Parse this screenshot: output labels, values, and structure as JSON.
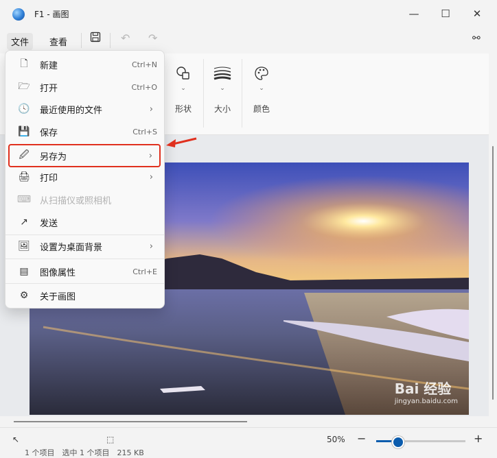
{
  "window": {
    "title": "F1 - 画图"
  },
  "menubar": {
    "file": "文件",
    "view": "查看"
  },
  "ribbon": {
    "shapes_label": "形状",
    "size_label": "大小",
    "colors_label": "颜色"
  },
  "file_menu": {
    "items": [
      {
        "label": "新建",
        "shortcut": "Ctrl+N",
        "icon": "new-file-icon"
      },
      {
        "label": "打开",
        "shortcut": "Ctrl+O",
        "icon": "folder-open-icon"
      },
      {
        "label": "最近使用的文件",
        "shortcut": "",
        "icon": "clock-icon",
        "submenu": true
      },
      {
        "label": "保存",
        "shortcut": "Ctrl+S",
        "icon": "save-icon"
      },
      {
        "label": "另存为",
        "shortcut": "",
        "icon": "save-as-icon",
        "submenu": true,
        "highlighted": true
      },
      {
        "label": "打印",
        "shortcut": "",
        "icon": "printer-icon",
        "submenu": true
      },
      {
        "label": "从扫描仪或照相机",
        "shortcut": "",
        "icon": "scanner-icon",
        "disabled": true
      },
      {
        "label": "发送",
        "shortcut": "",
        "icon": "share-icon"
      },
      {
        "label": "设置为桌面背景",
        "shortcut": "",
        "icon": "wallpaper-icon",
        "submenu": true
      },
      {
        "label": "图像属性",
        "shortcut": "Ctrl+E",
        "icon": "image-properties-icon"
      },
      {
        "label": "关于画图",
        "shortcut": "",
        "icon": "gear-icon"
      }
    ]
  },
  "statusbar": {
    "zoom": "50%",
    "zoom_level": 0.23,
    "below_text": "1 个项目　选中 1 个项目　215 KB"
  },
  "watermark": {
    "brand": "Bai 经验",
    "url": "jingyan.baidu.com"
  },
  "colors": {
    "highlight": "#e0301e",
    "accent": "#0b5cad"
  }
}
